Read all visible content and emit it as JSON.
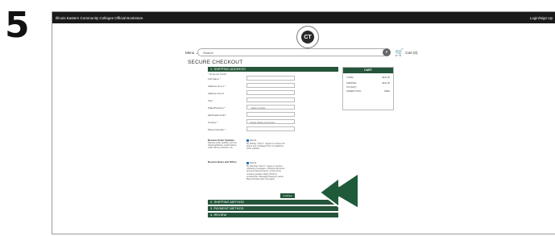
{
  "step_number": "5",
  "topbar": {
    "site_title": "Illinois Eastern Community Colleges Official Bookstore",
    "login": "Login/Sign Up"
  },
  "logo_text": "CT",
  "header": {
    "menu_label": "Menu",
    "search_placeholder": "Search",
    "search_icon": "magnifier-icon",
    "cart_label": "Cart (0)"
  },
  "checkout": {
    "title": "SECURE CHECKOUT",
    "shipping_bar": "1. SHIPPING ADDRESS",
    "required_note": "* Required Fields",
    "fields": [
      {
        "label": "Full Name *",
        "value": ""
      },
      {
        "label": "Address Line 1 *",
        "value": ""
      },
      {
        "label": "Address Line 2",
        "value": ""
      },
      {
        "label": "City *",
        "value": ""
      },
      {
        "label": "State/Province *",
        "value": "- Select a State -"
      },
      {
        "label": "Zip/Postal Code *",
        "value": ""
      },
      {
        "label": "Country *",
        "value": "United States of America"
      },
      {
        "label": "Phone Number *",
        "value": ""
      }
    ],
    "order_updates_label": "Receive Order Updates",
    "order_updates_desc": "Receive order updates such as shipping/delivery confirmations, order status reminders, etc.",
    "order_updates_opt": "Opt-In",
    "order_updates_consent": "By clicking \"Opt-In\" I agree to receive cell phone text messages from us regarding order updates.",
    "news_label": "Receive News and Offers",
    "news_opt": "Opt-In",
    "news_consent": "By selecting \"Opt-In\" I agree to receive marketing messages, including discounts and promotional events, at the phone number provided. Reply STOP to unsubscribe. Message frequency varies. Msg and data rates may apply.",
    "continue_label": "Continue",
    "sections": [
      "2. SHIPPING METHOD",
      "3. PAYMENT METHOD",
      "4. REVIEW"
    ]
  },
  "cart": {
    "header": "CART",
    "rows": [
      {
        "label": "0 ITEM",
        "value": "$101.35"
      },
      {
        "label": "SHIPPING:",
        "value": "$101.35"
      },
      {
        "label": "TAX (EST):",
        "value": ""
      },
      {
        "label": "ORDER TOTAL:",
        "value": "FREE"
      }
    ]
  },
  "colors": {
    "accent": "#25553a",
    "topbar": "#1a1a1a",
    "arrow": "#1f5a3a"
  }
}
